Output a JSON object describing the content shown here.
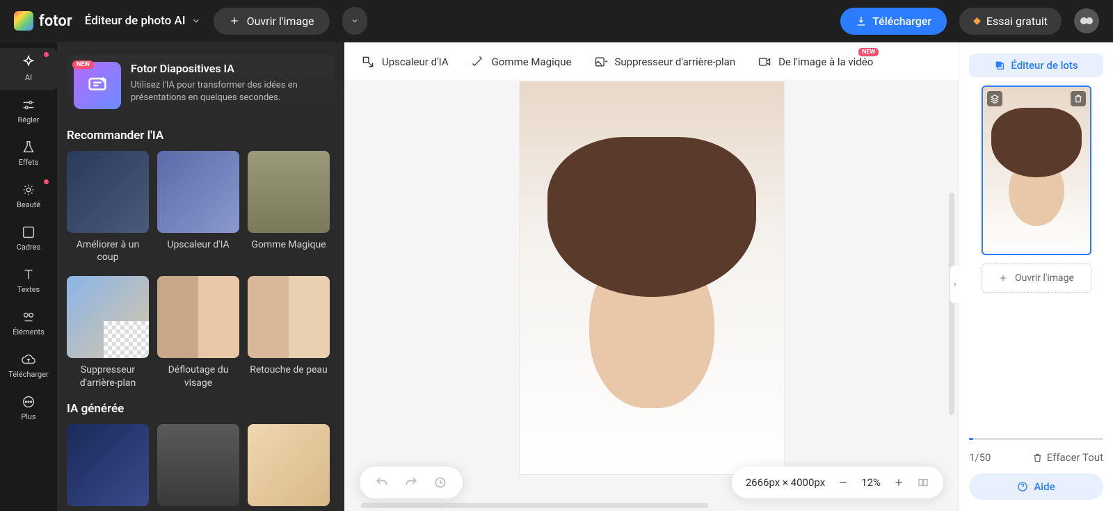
{
  "header": {
    "logo_text": "fotor",
    "editor_label": "Éditeur de photo AI",
    "open_image": "Ouvrir l'image",
    "download": "Télécharger",
    "trial": "Essai gratuit"
  },
  "sidebar": {
    "items": [
      {
        "label": "AI"
      },
      {
        "label": "Régler"
      },
      {
        "label": "Effets"
      },
      {
        "label": "Beauté"
      },
      {
        "label": "Cadres"
      },
      {
        "label": "Textes"
      },
      {
        "label": "Éléments"
      },
      {
        "label": "Télécharger"
      },
      {
        "label": "Plus"
      }
    ]
  },
  "panel": {
    "promo_badge": "NEW",
    "promo_title": "Fotor Diapositives IA",
    "promo_desc": "Utilisez l'IA pour transformer des idées en présentations en quelques secondes.",
    "section1": "Recommander l'IA",
    "cards1": [
      {
        "label": "Améliorer à un coup"
      },
      {
        "label": "Upscaleur d'IA"
      },
      {
        "label": "Gomme Magique"
      }
    ],
    "cards2": [
      {
        "label": "Suppresseur d'arrière-plan"
      },
      {
        "label": "Défloutage du visage"
      },
      {
        "label": "Retouche de peau"
      }
    ],
    "section2": "IA générée"
  },
  "tools": [
    {
      "label": "Upscaleur d'IA"
    },
    {
      "label": "Gomme Magique"
    },
    {
      "label": "Suppresseur d'arrière-plan"
    },
    {
      "label": "De l'image à la vidéo",
      "badge": "NEW"
    }
  ],
  "zoom": {
    "dims": "2666px × 4000px",
    "level": "12%"
  },
  "right": {
    "batch": "Éditeur de lots",
    "open": "Ouvrir l'image",
    "count": "1/50",
    "clear": "Effacer Tout",
    "help": "Aide"
  }
}
